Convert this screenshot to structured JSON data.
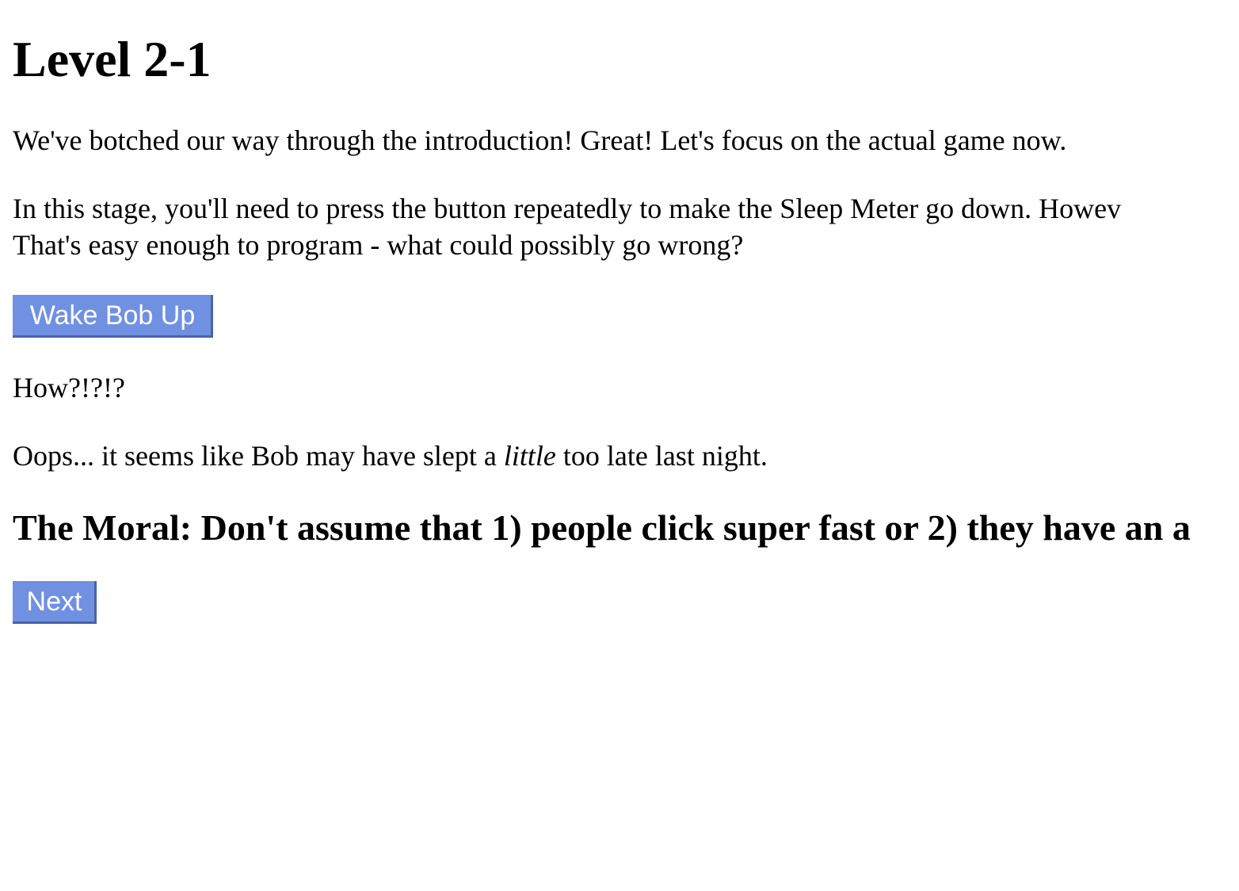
{
  "level": {
    "title": "Level 2-1",
    "intro": "We've botched our way through the introduction! Great! Let's focus on the actual game now.",
    "stage_line1": "In this stage, you'll need to press the button repeatedly to make the Sleep Meter go down. Howev",
    "stage_line2": "That's easy enough to program - what could possibly go wrong?",
    "wake_button_label": "Wake Bob Up",
    "how_text": "How?!?!?",
    "oops_before": "Oops... it seems like Bob may have slept a ",
    "oops_emphasis": "little",
    "oops_after": " too late last night.",
    "moral": "The Moral: Don't assume that 1) people click super fast or 2) they have an a",
    "next_button_label": "Next"
  },
  "colors": {
    "button_bg": "#7091e2",
    "button_text": "#ffffff",
    "button_shadow": "#4a63a8"
  }
}
